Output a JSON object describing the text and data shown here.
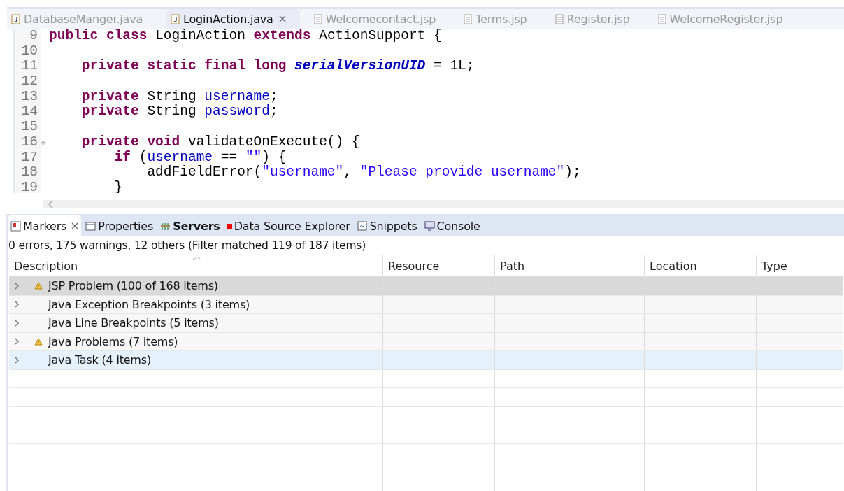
{
  "editor_tabs": [
    {
      "label": "DatabaseManger.java",
      "kind": "java",
      "selected": false,
      "closable": false
    },
    {
      "label": "LoginAction.java",
      "kind": "java",
      "selected": true,
      "closable": true
    },
    {
      "label": "Welcomecontact.jsp",
      "kind": "jsp",
      "selected": false,
      "closable": false
    },
    {
      "label": "Terms.jsp",
      "kind": "jsp",
      "selected": false,
      "closable": false
    },
    {
      "label": "Register.jsp",
      "kind": "jsp",
      "selected": false,
      "closable": false
    },
    {
      "label": "WelcomeRegister.jsp",
      "kind": "jsp",
      "selected": false,
      "closable": false
    }
  ],
  "code_lines": [
    {
      "number": "9",
      "fold": false,
      "tokens": [
        {
          "kind": "keyword",
          "text": "public"
        },
        {
          "kind": "keyword",
          "text": " class"
        },
        {
          "kind": "plain",
          "text": " LoginAction "
        },
        {
          "kind": "keyword",
          "text": "extends"
        },
        {
          "kind": "plain",
          "text": " ActionSupport {"
        }
      ]
    },
    {
      "number": "10",
      "fold": false
    },
    {
      "number": "11",
      "fold": false,
      "tokens": [
        {
          "kind": "keyword",
          "text": "    private static final long"
        },
        {
          "kind": "constant",
          "text": " serialVersionUID"
        },
        {
          "kind": "plain",
          "text": " = 1L;"
        }
      ]
    },
    {
      "number": "12",
      "fold": false
    },
    {
      "number": "13",
      "fold": false,
      "tokens": [
        {
          "kind": "keyword",
          "text": "    private"
        },
        {
          "kind": "plain",
          "text": " String "
        },
        {
          "kind": "field",
          "text": "username"
        },
        {
          "kind": "plain",
          "text": ";"
        }
      ]
    },
    {
      "number": "14",
      "fold": false,
      "tokens": [
        {
          "kind": "keyword",
          "text": "    private"
        },
        {
          "kind": "plain",
          "text": " String "
        },
        {
          "kind": "field",
          "text": "password"
        },
        {
          "kind": "plain",
          "text": ";"
        }
      ]
    },
    {
      "number": "15",
      "fold": false
    },
    {
      "number": "16",
      "fold": true,
      "tokens": [
        {
          "kind": "keyword",
          "text": "    private void"
        },
        {
          "kind": "plain",
          "text": " validateOnExecute() {"
        }
      ]
    },
    {
      "number": "17",
      "fold": false,
      "tokens": [
        {
          "kind": "keyword",
          "text": "        if"
        },
        {
          "kind": "plain",
          "text": " ("
        },
        {
          "kind": "field",
          "text": "username"
        },
        {
          "kind": "plain",
          "text": " == "
        },
        {
          "kind": "string",
          "text": "\"\""
        },
        {
          "kind": "plain",
          "text": ") {"
        }
      ]
    },
    {
      "number": "18",
      "fold": false,
      "tokens": [
        {
          "kind": "plain",
          "text": "            addFieldError("
        },
        {
          "kind": "string",
          "text": "\"username\""
        },
        {
          "kind": "plain",
          "text": ", "
        },
        {
          "kind": "string",
          "text": "\"Please provide username\""
        },
        {
          "kind": "plain",
          "text": ");"
        }
      ]
    },
    {
      "number": "19",
      "fold": false,
      "tokens": [
        {
          "kind": "plain",
          "text": "        }"
        }
      ]
    }
  ],
  "view_tabs": [
    {
      "label": "Markers",
      "kind": "markers",
      "selected": true,
      "bold": false,
      "closable": true
    },
    {
      "label": "Properties",
      "kind": "properties",
      "selected": false,
      "bold": false,
      "closable": false
    },
    {
      "label": "Servers",
      "kind": "servers",
      "selected": false,
      "bold": true,
      "closable": false
    },
    {
      "label": "Data Source Explorer",
      "kind": "datasource",
      "selected": false,
      "bold": false,
      "closable": false
    },
    {
      "label": "Snippets",
      "kind": "snippets",
      "selected": false,
      "bold": false,
      "closable": false
    },
    {
      "label": "Console",
      "kind": "console",
      "selected": false,
      "bold": false,
      "closable": false
    }
  ],
  "summary": "0 errors, 175 warnings, 12 others (Filter matched 119 of 187 items)",
  "table": {
    "columns": [
      "Description",
      "Resource",
      "Path",
      "Location",
      "Type"
    ],
    "rows": [
      {
        "description": "JSP Problem (100 of 168 items)",
        "warning": true,
        "selected": true,
        "hovered": false
      },
      {
        "description": "Java Exception Breakpoints (3 items)",
        "warning": false,
        "selected": false,
        "hovered": false
      },
      {
        "description": "Java Line Breakpoints (5 items)",
        "warning": false,
        "selected": false,
        "hovered": false
      },
      {
        "description": "Java Problems (7 items)",
        "warning": true,
        "selected": false,
        "hovered": false
      },
      {
        "description": "Java Task (4 items)",
        "warning": false,
        "selected": false,
        "hovered": true
      }
    ]
  }
}
